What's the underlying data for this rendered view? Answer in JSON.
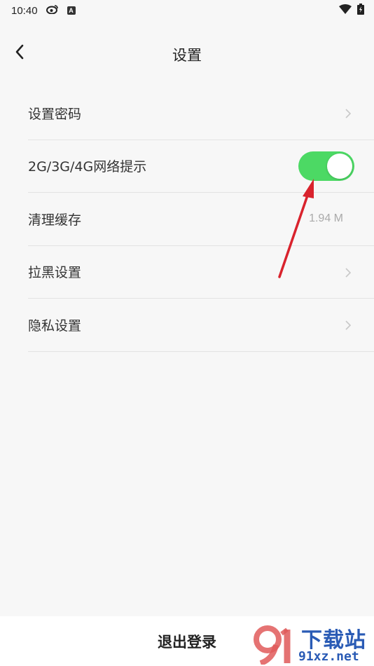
{
  "status_bar": {
    "time": "10:40",
    "icons": [
      "weibo-icon",
      "a-badge-icon",
      "wifi-icon",
      "battery-charging-icon"
    ],
    "badge_letter": "A"
  },
  "header": {
    "title": "设置"
  },
  "settings": {
    "items": [
      {
        "label": "设置密码",
        "control": "chevron"
      },
      {
        "label": "2G/3G/4G网络提示",
        "control": "toggle",
        "toggle_on": true
      },
      {
        "label": "清理缓存",
        "control": "value",
        "value": "1.94 M"
      },
      {
        "label": "拉黑设置",
        "control": "chevron"
      },
      {
        "label": "隐私设置",
        "control": "chevron"
      }
    ]
  },
  "footer": {
    "logout_label": "退出登录"
  },
  "watermark": {
    "line1": "下载站",
    "line2": "91xz.net",
    "logo_text": "91"
  },
  "colors": {
    "toggle_on": "#4cd964",
    "arrow": "#d9232d",
    "watermark": "#2a5bb5"
  }
}
